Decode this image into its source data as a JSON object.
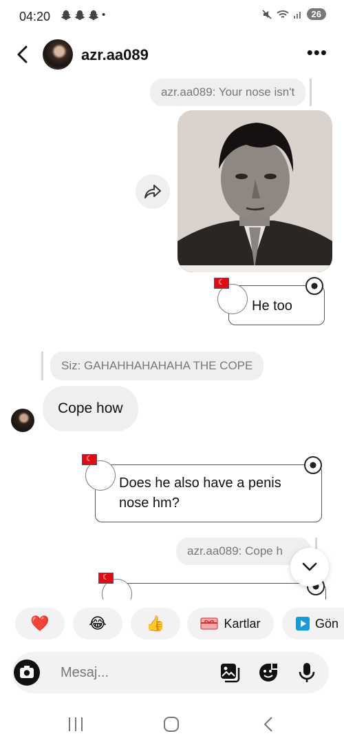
{
  "status_bar": {
    "time": "04:20",
    "notification_icons": [
      "snapchat-icon",
      "snapchat-icon",
      "snapchat-icon"
    ],
    "more_dot": "•",
    "battery": "26"
  },
  "header": {
    "username": "azr.aa089",
    "more": "•••"
  },
  "messages": {
    "reply1": "azr.aa089: Your nose isn't",
    "sticker1_text": "He too",
    "reply2": "Siz: GAHAHHAHAHAHA THE COPE",
    "incoming1": "Cope how",
    "sticker2_text": "Does he also have a penis nose hm?",
    "reply3": "azr.aa089: Cope h"
  },
  "quick_reactions": [
    {
      "icon": "heart-emoji",
      "glyph": "❤️"
    },
    {
      "icon": "laughing-emoji",
      "glyph": "😂"
    },
    {
      "icon": "thumbs-up-emoji",
      "glyph": "👍"
    },
    {
      "icon": "gift-card-icon",
      "label": "Kartlar"
    },
    {
      "icon": "send-icon",
      "label": "Gön"
    }
  ],
  "composer": {
    "placeholder": "Mesaj..."
  },
  "colors": {
    "bubble_gray": "#efefef",
    "accent_blue": "#1a9bd7",
    "turkey_red": "#e30a17"
  }
}
